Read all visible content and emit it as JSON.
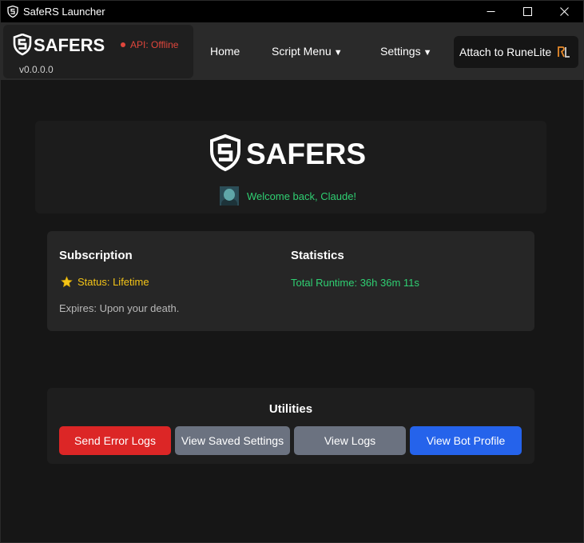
{
  "window": {
    "title": "SafeRS Launcher",
    "icon": "shield-s-icon",
    "controls": [
      "minimize-icon",
      "maximize-icon",
      "close-icon"
    ]
  },
  "brand": {
    "name": "SAFERS",
    "version": "v0.0.0.0",
    "api_status": "API: Offline",
    "api_status_color": "#e0463c"
  },
  "nav": {
    "home": "Home",
    "script_menu": "Script Menu",
    "settings": "Settings",
    "caret": "▼",
    "attach": "Attach to RuneLite",
    "attach_icon": "runelite-icon"
  },
  "header": {
    "logo_text": "SAFERS",
    "welcome": "Welcome back, Claude!",
    "welcome_color": "#2fcf72"
  },
  "subscription": {
    "title": "Subscription",
    "status": "Status: Lifetime",
    "status_icon": "star-icon",
    "status_color": "#f5c518",
    "expires": "Expires: Upon your death."
  },
  "statistics": {
    "title": "Statistics",
    "runtime": "Total Runtime: 36h 36m 11s"
  },
  "utilities": {
    "title": "Utilities",
    "buttons": [
      {
        "label": "Send Error Logs",
        "color": "#dc2626"
      },
      {
        "label": "View Saved Settings",
        "color": "#6b7280"
      },
      {
        "label": "View Logs",
        "color": "#6b7280"
      },
      {
        "label": "View Bot Profile",
        "color": "#2563eb"
      }
    ]
  }
}
